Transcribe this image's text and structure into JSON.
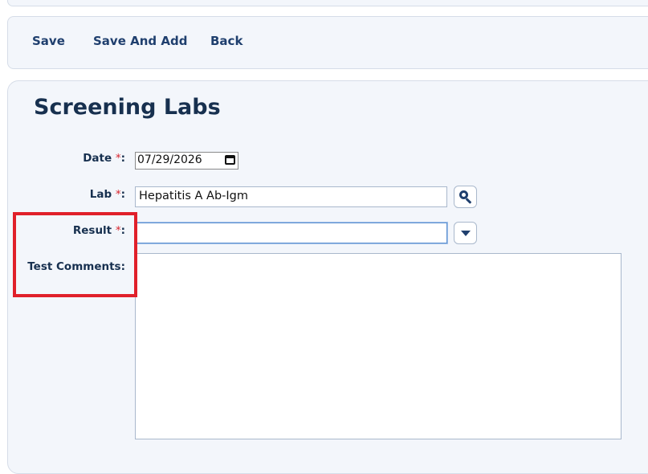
{
  "toolbar": {
    "save_label": "Save",
    "save_and_add_label": "Save And Add",
    "back_label": "Back"
  },
  "form": {
    "title": "Screening Labs",
    "required_marker": "*",
    "date": {
      "label": "Date",
      "value": "07/29/2026"
    },
    "lab": {
      "label": "Lab",
      "value": "Hepatitis A Ab-Igm"
    },
    "result": {
      "label": "Result",
      "value": ""
    },
    "comments": {
      "label": "Test Comments:",
      "value": ""
    }
  },
  "icons": {
    "lab_lookup": "search-icon",
    "result_dropdown": "chevron-down-icon",
    "date_picker": "calendar-icon"
  },
  "colors": {
    "accent": "#1f3f6e",
    "required": "#d7262e",
    "highlight": "#e0202a",
    "panel_bg": "#f3f6fb"
  }
}
